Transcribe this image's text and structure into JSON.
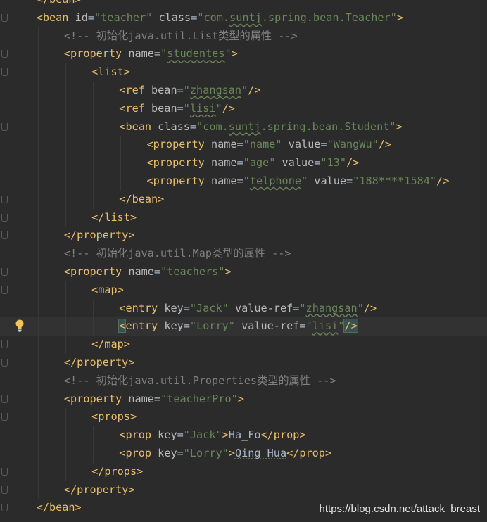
{
  "editor": {
    "lines": [
      {
        "indent": 1,
        "tokens": [
          [
            "tag",
            "</bean>"
          ]
        ]
      },
      {
        "indent": 1,
        "tokens": [
          [
            "tag",
            "<bean "
          ],
          [
            "attr",
            "id"
          ],
          [
            "text",
            "="
          ],
          [
            "val",
            "\"teacher\""
          ],
          [
            "text",
            " "
          ],
          [
            "attr",
            "class"
          ],
          [
            "text",
            "="
          ],
          [
            "val",
            "\"com."
          ],
          [
            "val_sq",
            "suntj"
          ],
          [
            "val",
            ".spring.bean.Teacher\""
          ],
          [
            "tag",
            ">"
          ]
        ]
      },
      {
        "indent": 2,
        "tokens": [
          [
            "comment",
            "<!-- 初始化java.util.List类型的属性 -->"
          ]
        ]
      },
      {
        "indent": 2,
        "tokens": [
          [
            "tag",
            "<property "
          ],
          [
            "attr",
            "name"
          ],
          [
            "text",
            "="
          ],
          [
            "val",
            "\""
          ],
          [
            "val_sq",
            "studentes"
          ],
          [
            "val",
            "\""
          ],
          [
            "tag",
            ">"
          ]
        ]
      },
      {
        "indent": 3,
        "tokens": [
          [
            "tag",
            "<list>"
          ]
        ]
      },
      {
        "indent": 4,
        "tokens": [
          [
            "tag",
            "<ref "
          ],
          [
            "attr",
            "bean"
          ],
          [
            "text",
            "="
          ],
          [
            "val",
            "\""
          ],
          [
            "val_sq",
            "zhangsan"
          ],
          [
            "val",
            "\""
          ],
          [
            "tag",
            "/>"
          ]
        ]
      },
      {
        "indent": 4,
        "tokens": [
          [
            "tag",
            "<ref "
          ],
          [
            "attr",
            "bean"
          ],
          [
            "text",
            "="
          ],
          [
            "val",
            "\""
          ],
          [
            "val_sq",
            "lisi"
          ],
          [
            "val",
            "\""
          ],
          [
            "tag",
            "/>"
          ]
        ]
      },
      {
        "indent": 4,
        "tokens": [
          [
            "tag",
            "<bean "
          ],
          [
            "attr",
            "class"
          ],
          [
            "text",
            "="
          ],
          [
            "val",
            "\"com."
          ],
          [
            "val_sq",
            "suntj"
          ],
          [
            "val",
            ".spring.bean.Student\""
          ],
          [
            "tag",
            ">"
          ]
        ]
      },
      {
        "indent": 5,
        "tokens": [
          [
            "tag",
            "<property "
          ],
          [
            "attr",
            "name"
          ],
          [
            "text",
            "="
          ],
          [
            "val",
            "\"name\""
          ],
          [
            "text",
            " "
          ],
          [
            "attr",
            "value"
          ],
          [
            "text",
            "="
          ],
          [
            "val",
            "\"WangWu\""
          ],
          [
            "tag",
            "/>"
          ]
        ]
      },
      {
        "indent": 5,
        "tokens": [
          [
            "tag",
            "<property "
          ],
          [
            "attr",
            "name"
          ],
          [
            "text",
            "="
          ],
          [
            "val",
            "\"age\""
          ],
          [
            "text",
            " "
          ],
          [
            "attr",
            "value"
          ],
          [
            "text",
            "="
          ],
          [
            "val",
            "\"13\""
          ],
          [
            "tag",
            "/>"
          ]
        ]
      },
      {
        "indent": 5,
        "tokens": [
          [
            "tag",
            "<property "
          ],
          [
            "attr",
            "name"
          ],
          [
            "text",
            "="
          ],
          [
            "val",
            "\""
          ],
          [
            "val_sq",
            "telphone"
          ],
          [
            "val",
            "\""
          ],
          [
            "text",
            " "
          ],
          [
            "attr",
            "value"
          ],
          [
            "text",
            "="
          ],
          [
            "val",
            "\"188****1584\""
          ],
          [
            "tag",
            "/>"
          ]
        ]
      },
      {
        "indent": 4,
        "tokens": [
          [
            "tag",
            "</bean>"
          ]
        ]
      },
      {
        "indent": 3,
        "tokens": [
          [
            "tag",
            "</list>"
          ]
        ]
      },
      {
        "indent": 2,
        "tokens": [
          [
            "tag",
            "</property>"
          ]
        ]
      },
      {
        "indent": 2,
        "tokens": [
          [
            "comment",
            "<!-- 初始化java.util.Map类型的属性 -->"
          ]
        ]
      },
      {
        "indent": 2,
        "tokens": [
          [
            "tag",
            "<property "
          ],
          [
            "attr",
            "name"
          ],
          [
            "text",
            "="
          ],
          [
            "val",
            "\"teachers\""
          ],
          [
            "tag",
            ">"
          ]
        ]
      },
      {
        "indent": 3,
        "tokens": [
          [
            "tag",
            "<map>"
          ]
        ]
      },
      {
        "indent": 4,
        "tokens": [
          [
            "tag",
            "<entry "
          ],
          [
            "attr",
            "key"
          ],
          [
            "text",
            "="
          ],
          [
            "val",
            "\"Jack\""
          ],
          [
            "text",
            " "
          ],
          [
            "attr",
            "value-ref"
          ],
          [
            "text",
            "="
          ],
          [
            "val",
            "\""
          ],
          [
            "val_sq",
            "zhangsan"
          ],
          [
            "val",
            "\""
          ],
          [
            "tag",
            "/>"
          ]
        ]
      },
      {
        "indent": 4,
        "current": true,
        "bulb": true,
        "tokens": [
          [
            "tag_match",
            "<"
          ],
          [
            "tag",
            "entry "
          ],
          [
            "attr",
            "key"
          ],
          [
            "text",
            "="
          ],
          [
            "val",
            "\"Lorry\""
          ],
          [
            "text",
            " "
          ],
          [
            "attr",
            "value-ref"
          ],
          [
            "text",
            "="
          ],
          [
            "val",
            "\""
          ],
          [
            "val_sq",
            "lisi"
          ],
          [
            "val",
            "\""
          ],
          [
            "tag_match",
            "/>"
          ]
        ]
      },
      {
        "indent": 3,
        "tokens": [
          [
            "tag",
            "</map>"
          ]
        ]
      },
      {
        "indent": 2,
        "tokens": [
          [
            "tag",
            "</property>"
          ]
        ]
      },
      {
        "indent": 2,
        "tokens": [
          [
            "comment",
            "<!-- 初始化java.util.Properties类型的属性 -->"
          ]
        ]
      },
      {
        "indent": 2,
        "tokens": [
          [
            "tag",
            "<property "
          ],
          [
            "attr",
            "name"
          ],
          [
            "text",
            "="
          ],
          [
            "val",
            "\"teacherPro\""
          ],
          [
            "tag",
            ">"
          ]
        ]
      },
      {
        "indent": 3,
        "tokens": [
          [
            "tag",
            "<props>"
          ]
        ]
      },
      {
        "indent": 4,
        "tokens": [
          [
            "tag",
            "<prop "
          ],
          [
            "attr",
            "key"
          ],
          [
            "text",
            "="
          ],
          [
            "val",
            "\"Jack\""
          ],
          [
            "tag",
            ">"
          ],
          [
            "text",
            "Ha_Fo"
          ],
          [
            "tag",
            "</prop>"
          ]
        ]
      },
      {
        "indent": 4,
        "tokens": [
          [
            "tag",
            "<prop "
          ],
          [
            "attr",
            "key"
          ],
          [
            "text",
            "="
          ],
          [
            "val",
            "\"Lorry\""
          ],
          [
            "tag",
            ">"
          ],
          [
            "text_sq",
            "Qing_Hua"
          ],
          [
            "tag",
            "</prop>"
          ]
        ]
      },
      {
        "indent": 3,
        "tokens": [
          [
            "tag",
            "</props>"
          ]
        ]
      },
      {
        "indent": 2,
        "tokens": [
          [
            "tag",
            "</property>"
          ]
        ]
      },
      {
        "indent": 1,
        "tokens": [
          [
            "tag",
            "</bean>"
          ]
        ]
      }
    ]
  },
  "watermark": "https://blog.csdn.net/attack_breast",
  "colors": {
    "background": "#2b2b2b",
    "tag": "#e8bf6a",
    "attribute": "#bababa",
    "value": "#6a8759",
    "comment": "#808080",
    "current_line": "#323232"
  }
}
